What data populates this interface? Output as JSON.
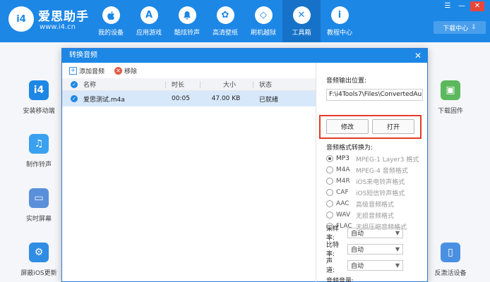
{
  "app": {
    "logo_text": "i4",
    "brand": "爱思助手",
    "url": "www.i4.cn",
    "accent_color": "#1d87e6"
  },
  "nav": [
    {
      "label": "我的设备",
      "icon": "apple-icon",
      "glyph": ""
    },
    {
      "label": "应用游戏",
      "icon": "app-store-icon",
      "glyph": "A"
    },
    {
      "label": "酷炫铃声",
      "icon": "bell-icon",
      "glyph": "♪"
    },
    {
      "label": "高清壁纸",
      "icon": "flower-icon",
      "glyph": "✿"
    },
    {
      "label": "刷机越狱",
      "icon": "dropbox-icon",
      "glyph": "◇"
    },
    {
      "label": "工具箱",
      "icon": "tools-icon",
      "glyph": "✕"
    },
    {
      "label": "教程中心",
      "icon": "info-icon",
      "glyph": "i"
    }
  ],
  "window": {
    "download_center": "下载中心",
    "download_icon": "download-arrow-icon"
  },
  "background_tools": [
    {
      "label": "安装移动端",
      "color": "#1d87e6",
      "glyph": "i4"
    },
    {
      "label": "制作铃声",
      "color": "#3aa0f0",
      "glyph": "♫"
    },
    {
      "label": "实时屏幕",
      "color": "#5a8fd9",
      "glyph": "▭"
    },
    {
      "label": "屏蔽iOS更新",
      "color": "#2f8de4",
      "glyph": "⚙"
    },
    {
      "label": "下载固件",
      "color": "#5cb85c",
      "glyph": "▣"
    },
    {
      "label": "反激活设备",
      "color": "#4a90e2",
      "glyph": "▯"
    }
  ],
  "dialog": {
    "title": "转换音频",
    "toolbar": {
      "add_label": "添加音频",
      "remove_label": "移除"
    },
    "columns": {
      "name": "名称",
      "duration": "时长",
      "size": "大小",
      "status": "状态"
    },
    "rows": [
      {
        "name": "爱思测试.m4a",
        "duration": "00:05",
        "size": "47.00 KB",
        "status": "已就绪"
      }
    ],
    "output": {
      "label": "音频输出位置:",
      "path": "F:\\i4Tools7\\Files\\ConvertedAu",
      "modify_label": "修改",
      "open_label": "打开"
    },
    "format": {
      "label": "音频格式转换为:",
      "selected": "MP3",
      "options": [
        {
          "code": "MP3",
          "desc": "MPEG-1 Layer3 格式"
        },
        {
          "code": "M4A",
          "desc": "MPEG-4 音频格式"
        },
        {
          "code": "M4R",
          "desc": "iOS来电铃声格式"
        },
        {
          "code": "CAF",
          "desc": "iOS短信铃声格式"
        },
        {
          "code": "AAC",
          "desc": "高级音频格式"
        },
        {
          "code": "WAV",
          "desc": "无损音频格式"
        },
        {
          "code": "FLAC",
          "desc": "无损压缩音频格式"
        }
      ]
    },
    "sample_rate": {
      "label": "采样率:",
      "value": "自动"
    },
    "bitrate": {
      "label": "比特率:",
      "value": "自动"
    },
    "channel": {
      "label": "声　道:",
      "value": "自动"
    },
    "volume_label": "音频音量:"
  }
}
